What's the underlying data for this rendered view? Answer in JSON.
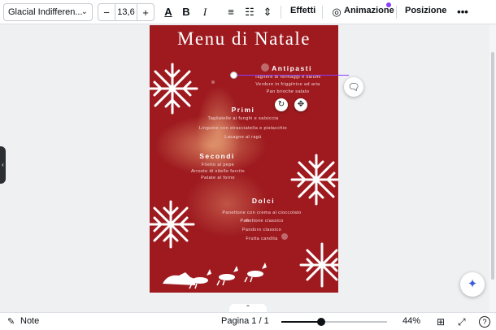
{
  "toolbar": {
    "font": "Glacial Indifferen...",
    "font_size": "13,6",
    "effects": "Effetti",
    "animation": "Animazione",
    "position": "Posizione",
    "accent": "#8b3dff"
  },
  "menu": {
    "title": "Menu di Natale",
    "sections": [
      {
        "title": "Antipasti",
        "items": [
          "Tagliere di formaggi e salumi",
          "Verdure in friggitrice ad aria",
          "Pan brioche salato"
        ]
      },
      {
        "title": "Primi",
        "items": [
          "Tagliatelle ai funghi e salsiccia",
          "Linguine con stracciatella e pistacchio",
          "Lasagne al ragù"
        ]
      },
      {
        "title": "Secondi",
        "items": [
          "Filetto al pepe",
          "Arrosto di vitello farcito",
          "Patate al forno"
        ]
      },
      {
        "title": "Dolci",
        "items": [
          "Panettone con crema al cioccolato",
          "Panettone classico",
          "Pandoro classico",
          "Frutta candita"
        ]
      }
    ],
    "background": "#9e1a1f"
  },
  "bottombar": {
    "notes": "Note",
    "page": "Pagina 1 / 1",
    "zoom": "44%",
    "zoom_fraction": 0.38
  },
  "icons": {
    "notes": "notes-icon",
    "grid": "grid-view-icon",
    "expand": "fullscreen-icon",
    "help": "help-icon"
  }
}
